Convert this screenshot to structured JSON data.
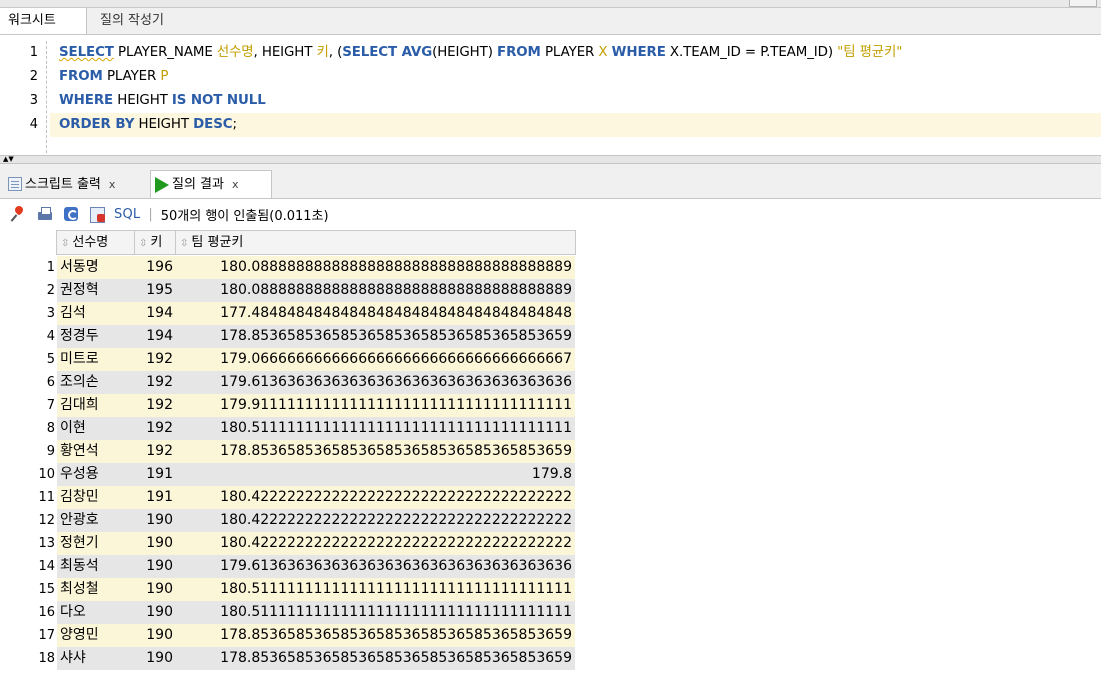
{
  "worksheet_tabs": {
    "active": "워크시트",
    "inactive": "질의 작성기"
  },
  "editor": {
    "lines": [
      {
        "num": "1",
        "segments": [
          {
            "t": "SELECT",
            "c": "kw squig"
          },
          {
            "t": " PLAYER_NAME ",
            "c": ""
          },
          {
            "t": "선수명",
            "c": "al"
          },
          {
            "t": ", HEIGHT ",
            "c": ""
          },
          {
            "t": "키",
            "c": "al"
          },
          {
            "t": ", (",
            "c": ""
          },
          {
            "t": "SELECT AVG",
            "c": "kw"
          },
          {
            "t": "(HEIGHT) ",
            "c": ""
          },
          {
            "t": "FROM",
            "c": "kw"
          },
          {
            "t": " PLAYER ",
            "c": ""
          },
          {
            "t": "X",
            "c": "al"
          },
          {
            "t": " ",
            "c": ""
          },
          {
            "t": "WHERE",
            "c": "kw"
          },
          {
            "t": " X.TEAM_ID = P.TEAM_ID) ",
            "c": ""
          },
          {
            "t": "\"팀 평균키\"",
            "c": "al"
          }
        ]
      },
      {
        "num": "2",
        "segments": [
          {
            "t": "FROM",
            "c": "kw"
          },
          {
            "t": " PLAYER ",
            "c": ""
          },
          {
            "t": "P",
            "c": "al"
          }
        ]
      },
      {
        "num": "3",
        "segments": [
          {
            "t": "WHERE",
            "c": "kw"
          },
          {
            "t": " HEIGHT ",
            "c": ""
          },
          {
            "t": "IS NOT NULL",
            "c": "kw"
          }
        ]
      },
      {
        "num": "4",
        "segments": [
          {
            "t": "ORDER BY",
            "c": "kw"
          },
          {
            "t": " HEIGHT ",
            "c": ""
          },
          {
            "t": "DESC",
            "c": "kw"
          },
          {
            "t": ";",
            "c": ""
          }
        ]
      }
    ]
  },
  "result_tabs": {
    "script_output": "스크립트 출력",
    "query_result": "질의 결과",
    "close_glyph": "x"
  },
  "toolbar": {
    "sql_label": "SQL",
    "separator": "|",
    "status": "50개의 행이 인출됨(0.011초)"
  },
  "grid": {
    "columns": [
      "선수명",
      "키",
      "팀 평균키"
    ],
    "sort_glyph": "⇳",
    "rows": [
      [
        "1",
        "서동명",
        "196",
        "180.088888888888888888888888888888888889"
      ],
      [
        "2",
        "권정혁",
        "195",
        "180.088888888888888888888888888888888889"
      ],
      [
        "3",
        "김석",
        "194",
        "177.484848484848484848484848484848484848"
      ],
      [
        "4",
        "정경두",
        "194",
        "178.853658536585365853658536585365853659"
      ],
      [
        "5",
        "미트로",
        "192",
        "179.066666666666666666666666666666666667"
      ],
      [
        "6",
        "조의손",
        "192",
        "179.613636363636363636363636363636363636"
      ],
      [
        "7",
        "김대희",
        "192",
        "179.911111111111111111111111111111111111"
      ],
      [
        "8",
        "이현",
        "192",
        "180.511111111111111111111111111111111111"
      ],
      [
        "9",
        "황연석",
        "192",
        "178.853658536585365853658536585365853659"
      ],
      [
        "10",
        "우성용",
        "191",
        "179.8"
      ],
      [
        "11",
        "김창민",
        "191",
        "180.422222222222222222222222222222222222"
      ],
      [
        "12",
        "안광호",
        "190",
        "180.422222222222222222222222222222222222"
      ],
      [
        "13",
        "정현기",
        "190",
        "180.422222222222222222222222222222222222"
      ],
      [
        "14",
        "최동석",
        "190",
        "179.613636363636363636363636363636363636"
      ],
      [
        "15",
        "최성철",
        "190",
        "180.511111111111111111111111111111111111"
      ],
      [
        "16",
        "다오",
        "190",
        "180.511111111111111111111111111111111111"
      ],
      [
        "17",
        "양영민",
        "190",
        "178.853658536585365853658536585365853659"
      ],
      [
        "18",
        "샤샤",
        "190",
        "178.853658536585365853658536585365853659"
      ]
    ]
  }
}
